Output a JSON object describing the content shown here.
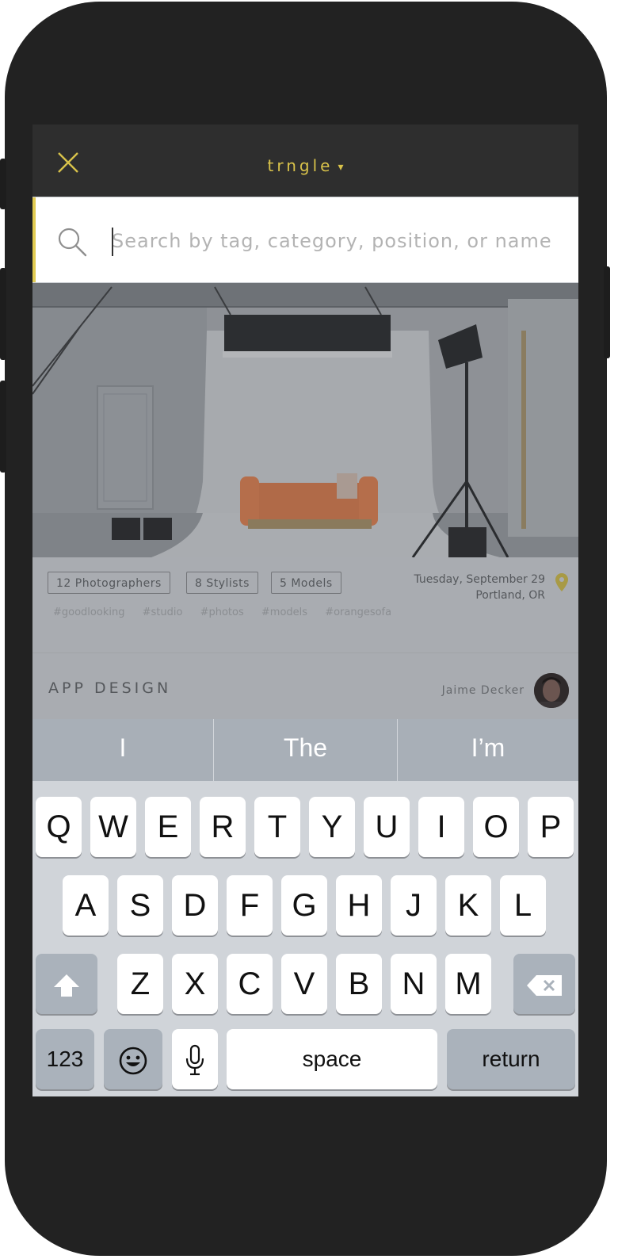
{
  "app": {
    "brand": "trngle",
    "brand_caret": "▾"
  },
  "search": {
    "placeholder": "Search by tag, category, position, or name"
  },
  "event": {
    "chips": [
      "12  Photographers",
      "8  Stylists",
      "5   Models"
    ],
    "tags": [
      "#goodlooking",
      "#studio",
      "#photos",
      "#models",
      "#orangesofa"
    ],
    "date": "Tuesday, September 29",
    "location": "Portland, OR",
    "section_title": "APP DESIGN",
    "author": "Jaime Decker"
  },
  "keyboard": {
    "suggestions": [
      "I",
      "The",
      "I’m"
    ],
    "row1": [
      "Q",
      "W",
      "E",
      "R",
      "T",
      "Y",
      "U",
      "I",
      "O",
      "P"
    ],
    "row2": [
      "A",
      "S",
      "D",
      "F",
      "G",
      "H",
      "J",
      "K",
      "L"
    ],
    "row3": [
      "Z",
      "X",
      "C",
      "V",
      "B",
      "N",
      "M"
    ],
    "numbers_label": "123",
    "space_label": "space",
    "return_label": "return"
  },
  "colors": {
    "accent": "#e1cb52",
    "topbar": "#2e2e2e",
    "phone_body": "#222222"
  }
}
